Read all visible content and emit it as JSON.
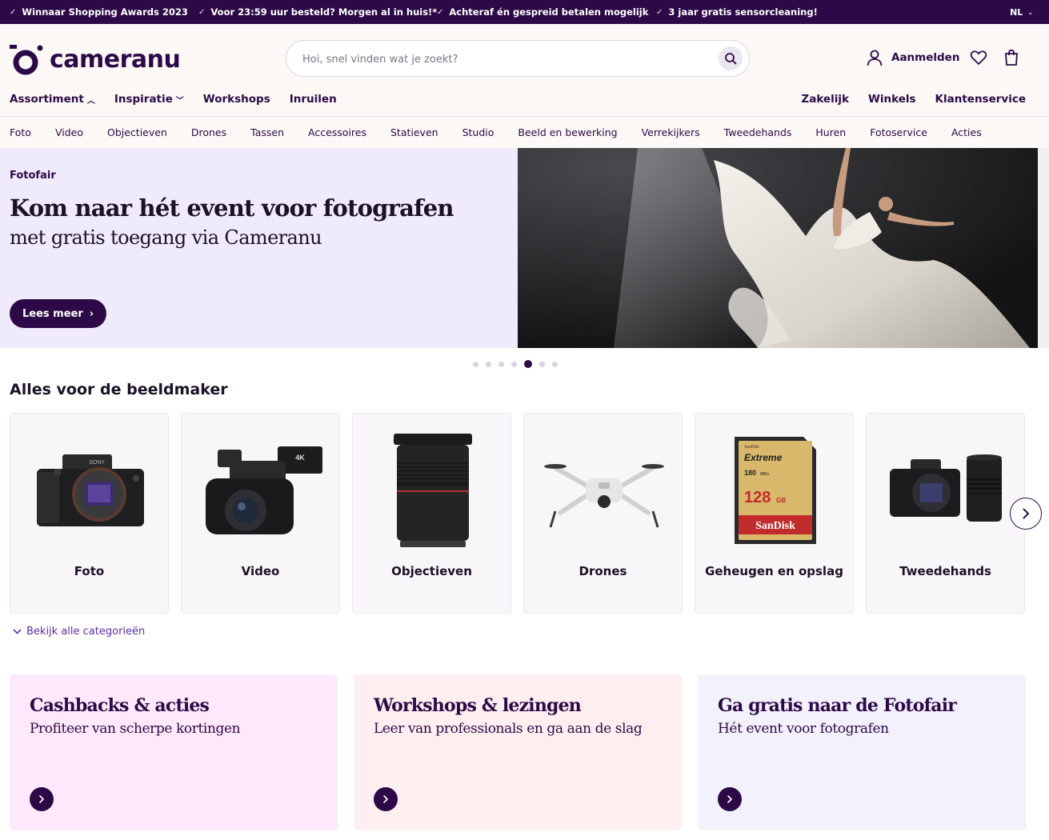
{
  "usp": [
    {
      "text": "Winnaar Shopping Awards 2023"
    },
    {
      "text": "Voor 23:59 uur besteld? Morgen al in huis!*"
    },
    {
      "text": "Achteraf én gespreid betalen mogelijk"
    },
    {
      "text": "3 jaar gratis sensorcleaning!"
    }
  ],
  "language": "NL",
  "logo": {
    "text": "cameranu"
  },
  "search": {
    "placeholder": "Hoi, snel vinden wat je zoekt?"
  },
  "account": {
    "login_label": "Aanmelden"
  },
  "main_nav": {
    "assortiment": "Assortiment",
    "inspiratie": "Inspiratie",
    "workshops": "Workshops",
    "inruilen": "Inruilen"
  },
  "right_nav": {
    "zakelijk": "Zakelijk",
    "winkels": "Winkels",
    "klantenservice": "Klantenservice"
  },
  "category_nav": [
    "Foto",
    "Video",
    "Objectieven",
    "Drones",
    "Tassen",
    "Accessoires",
    "Statieven",
    "Studio",
    "Beeld en bewerking",
    "Verrekijkers",
    "Tweedehands",
    "Huren",
    "Fotoservice",
    "Acties"
  ],
  "hero": {
    "eyebrow": "Fotofair",
    "title": "Kom naar hét event voor fotografen",
    "subtitle": "met gratis toegang via Cameranu",
    "button": "Lees meer",
    "slides_total": 7,
    "slide_active": 5
  },
  "section": {
    "title": "Alles voor de beeldmaker"
  },
  "categories": [
    {
      "label": "Foto",
      "icon": "mirrorless-camera-icon"
    },
    {
      "label": "Video",
      "icon": "camcorder-icon"
    },
    {
      "label": "Objectieven",
      "icon": "lens-icon"
    },
    {
      "label": "Drones",
      "icon": "drone-icon"
    },
    {
      "label": "Geheugen en opslag",
      "icon": "sd-card-icon"
    },
    {
      "label": "Tweedehands",
      "icon": "camera-with-lens-icon"
    }
  ],
  "all_categories": "Bekijk alle categorieën",
  "sd_card": {
    "brand_line": "SanDisk",
    "product_line": "Extreme",
    "speed": "180",
    "speed_unit": "MB/s",
    "capacity": "128",
    "capacity_unit": "GB",
    "brand": "SanDisk"
  },
  "promos": [
    {
      "title": "Cashbacks & acties",
      "subtitle": "Profiteer van scherpe kortingen",
      "bg": "#fde9fb"
    },
    {
      "title": "Workshops & lezingen",
      "subtitle": "Leer van professionals en ga aan de slag",
      "bg": "#fdeef0"
    },
    {
      "title": "Ga gratis naar de Fotofair",
      "subtitle": "Hét event voor fotografen",
      "bg": "#f2f1fc"
    }
  ],
  "colors": {
    "brand": "#2d0a47",
    "link": "#5b2ea6",
    "hero_bg": "#efeafc"
  }
}
